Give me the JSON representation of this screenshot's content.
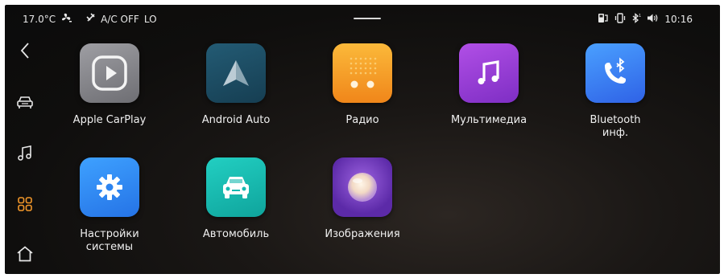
{
  "status": {
    "temperature": "17.0°C",
    "ac": "A/C OFF",
    "fan": "LO",
    "time": "10:16"
  },
  "sidebar": {
    "items": [
      {
        "icon": "back-icon"
      },
      {
        "icon": "car-icon"
      },
      {
        "icon": "music-icon"
      },
      {
        "icon": "apps-grid-icon",
        "active": true
      },
      {
        "icon": "home-icon"
      }
    ]
  },
  "apps": [
    {
      "label": "Apple CarPlay",
      "icon": "carplay-icon",
      "color": "#8e8e93"
    },
    {
      "label": "Android Auto",
      "icon": "android-auto-icon",
      "color": "#1f4f66"
    },
    {
      "label": "Радио",
      "icon": "radio-icon",
      "color": "#f39a1d"
    },
    {
      "label": "Мультимедиа",
      "icon": "music-note-icon",
      "color": "#9a3fd6"
    },
    {
      "label": "Bluetooth\nинф.",
      "icon": "bluetooth-phone-icon",
      "color": "#3a7ff5"
    },
    {
      "label": "Настройки\nсистемы",
      "icon": "settings-gear-icon",
      "color": "#2f8ef0"
    },
    {
      "label": "Автомобиль",
      "icon": "car-front-icon",
      "color": "#17b9b0"
    },
    {
      "label": "Изображения",
      "icon": "gallery-icon",
      "color": "#7b3fcf"
    }
  ],
  "colors": {
    "accent": "#f0962a",
    "background": "#121110",
    "text": "#f0f0f0"
  }
}
